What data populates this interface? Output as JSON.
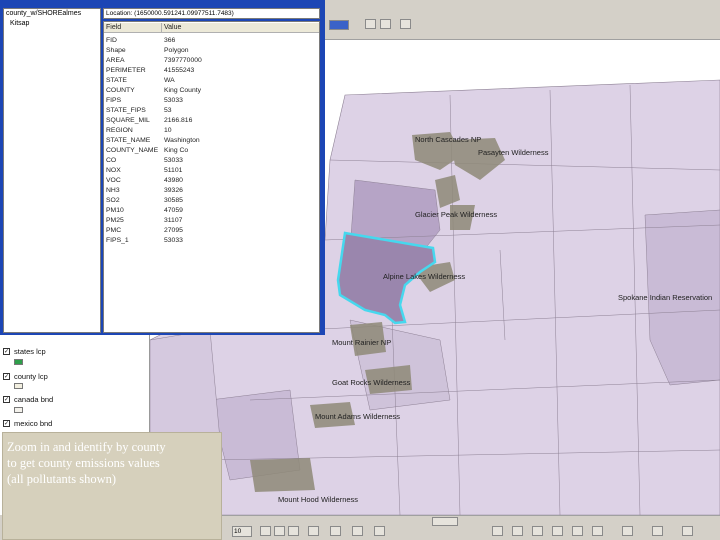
{
  "identify": {
    "layer_tree_item": "county_w/SHOREalmes",
    "layer_tree_subitem": "Kitsap",
    "location": "Location: (1650000.591241.09977511.7483)",
    "columns": [
      "Field",
      "Value"
    ],
    "rows": [
      [
        "FID",
        "366"
      ],
      [
        "Shape",
        "Polygon"
      ],
      [
        "AREA",
        "7397770000"
      ],
      [
        "PERIMETER",
        "41555243"
      ],
      [
        "STATE",
        "WA"
      ],
      [
        "COUNTY",
        "King County"
      ],
      [
        "FIPS",
        "53033"
      ],
      [
        "STATE_FIPS",
        "53"
      ],
      [
        "SQUARE_MIL",
        "2166.816"
      ],
      [
        "REGION",
        "10"
      ],
      [
        "STATE_NAME",
        "Washington"
      ],
      [
        "COUNTY_NAME",
        "King Co"
      ],
      [
        "CO",
        "53033"
      ],
      [
        "NOX",
        "51101"
      ],
      [
        "VOC",
        "43980"
      ],
      [
        "NH3",
        "39326"
      ],
      [
        "SO2",
        "30585"
      ],
      [
        "PM10",
        "47059"
      ],
      [
        "PM25",
        "31107"
      ],
      [
        "PMC",
        "27095"
      ],
      [
        "FIPS_1",
        "53033"
      ]
    ]
  },
  "toc": {
    "layers": [
      {
        "label": "states lcp",
        "checked": true,
        "color": "#2e9e4a"
      },
      {
        "label": "county lcp",
        "checked": true,
        "color": "#f2efe0"
      },
      {
        "label": "canada bnd",
        "checked": true,
        "color": "#f4f2ec"
      },
      {
        "label": "mexico bnd",
        "checked": true,
        "color": "#f4f2ec"
      }
    ]
  },
  "map": {
    "labels": {
      "north_cascades": "North Cascades NP",
      "pasayten": "Pasayten Wilderness",
      "glacier_peak": "Glacier Peak Wilderness",
      "alpine_lakes": "Alpine Lakes Wilderness",
      "spokane": "Spokane Indian Reservation",
      "mount_rainier": "Mount Rainier NP",
      "goat_rocks": "Goat Rocks Wilderness",
      "mount_adams": "Mount Adams Wilderness",
      "mount_hood": "Mount Hood Wilderness"
    },
    "colors": {
      "base": "#ddd2e6",
      "county_dark": "#b6a4c6",
      "county_mid": "#c9bbd6",
      "wilderness": "#8f8a78",
      "highlight": "#46d8ee"
    }
  },
  "caption": {
    "lines": [
      "Zoom in and identify by county",
      "to get county emissions values",
      "(all pollutants shown)"
    ]
  },
  "toolbar": {
    "font_size": "10"
  }
}
